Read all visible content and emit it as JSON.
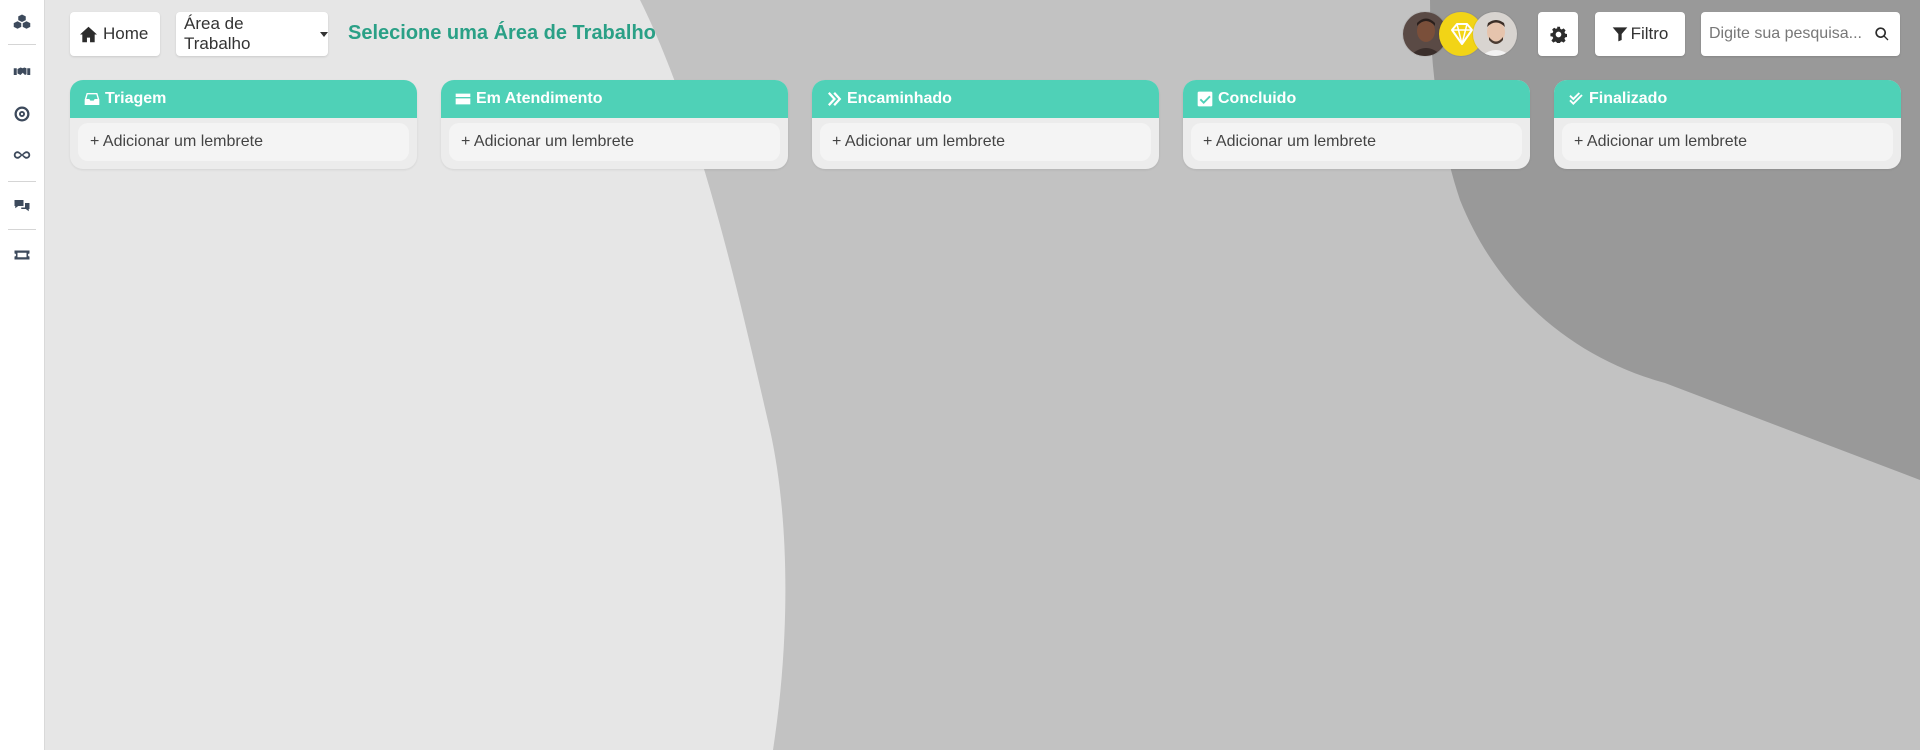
{
  "colors": {
    "accent": "#4fd1b7",
    "title": "#2aa086",
    "bg_light": "#e6e6e6",
    "bg_mid": "#c2c2c2",
    "bg_dark": "#999999"
  },
  "sidebar": {
    "items": [
      {
        "name": "dashboard",
        "icon": "cubes-icon"
      },
      {
        "name": "deals",
        "icon": "handshake-icon"
      },
      {
        "name": "goals",
        "icon": "target-icon"
      },
      {
        "name": "integrations",
        "icon": "infinity-icon"
      },
      {
        "name": "chats",
        "icon": "chat-bubbles-icon"
      },
      {
        "name": "tickets",
        "icon": "ticket-icon"
      }
    ]
  },
  "header": {
    "home_label": "Home",
    "workspace_select_label": "Área de Trabalho",
    "workspace_title": "Selecione uma Área de Trabalho",
    "filter_label": "Filtro",
    "search_placeholder": "Digite sua pesquisa..."
  },
  "board": {
    "columns": [
      {
        "title": "Triagem",
        "icon": "inbox-icon",
        "add_label": "+ Adicionar um lembrete"
      },
      {
        "title": "Em Atendimento",
        "icon": "card-icon",
        "add_label": "+ Adicionar um lembrete"
      },
      {
        "title": "Encaminhado",
        "icon": "double-chevron-right-icon",
        "add_label": "+ Adicionar um lembrete"
      },
      {
        "title": "Concluido",
        "icon": "checkbox-icon",
        "add_label": "+ Adicionar um lembrete"
      },
      {
        "title": "Finalizado",
        "icon": "double-check-icon",
        "add_label": "+ Adicionar um lembrete"
      }
    ]
  }
}
